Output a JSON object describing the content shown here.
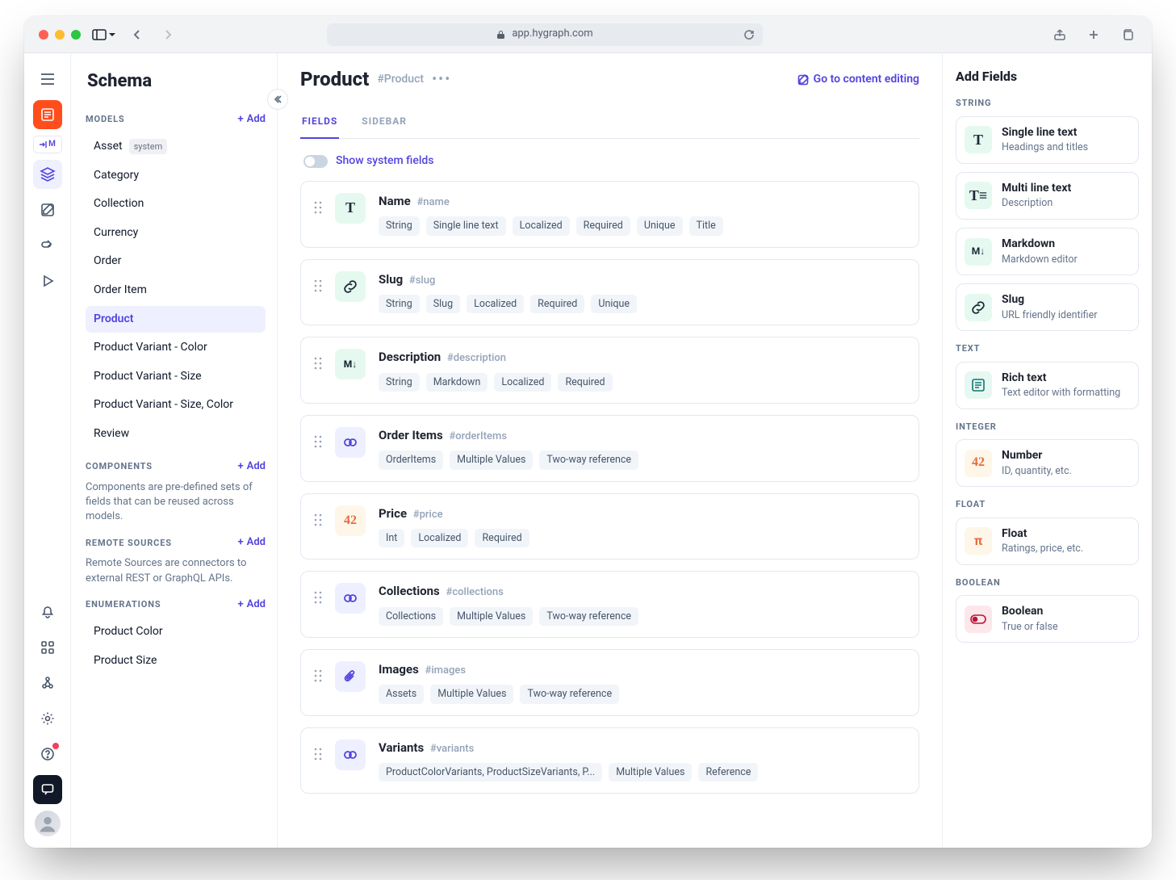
{
  "browser": {
    "url_host": "app.hygraph.com"
  },
  "rail": {
    "brand_short": "M"
  },
  "schema": {
    "title": "Schema",
    "sections": {
      "models": {
        "label": "MODELS",
        "add": "Add",
        "items": [
          {
            "label": "Asset",
            "system": true,
            "sys_label": "system"
          },
          {
            "label": "Category"
          },
          {
            "label": "Collection"
          },
          {
            "label": "Currency"
          },
          {
            "label": "Order"
          },
          {
            "label": "Order Item"
          },
          {
            "label": "Product",
            "active": true
          },
          {
            "label": "Product Variant - Color"
          },
          {
            "label": "Product Variant - Size"
          },
          {
            "label": "Product Variant - Size, Color"
          },
          {
            "label": "Review"
          }
        ]
      },
      "components": {
        "label": "COMPONENTS",
        "add": "Add",
        "help": "Components are pre-defined sets of fields that can be reused across models."
      },
      "remote": {
        "label": "REMOTE SOURCES",
        "add": "Add",
        "help": "Remote Sources are connectors to external REST or GraphQL APIs."
      },
      "enums": {
        "label": "ENUMERATIONS",
        "add": "Add",
        "items": [
          {
            "label": "Product Color"
          },
          {
            "label": "Product Size"
          }
        ]
      }
    }
  },
  "content": {
    "title": "Product",
    "api_id": "#Product",
    "cta": "Go to content editing",
    "tabs": {
      "fields": "FIELDS",
      "sidebar": "SIDEBAR"
    },
    "show_system_label": "Show system fields",
    "fields": [
      {
        "icon": "txt",
        "glyph": "T",
        "name": "Name",
        "hash": "#name",
        "chips": [
          "String",
          "Single line text",
          "Localized",
          "Required",
          "Unique",
          "Title"
        ]
      },
      {
        "icon": "link",
        "glyph": "",
        "name": "Slug",
        "hash": "#slug",
        "chips": [
          "String",
          "Slug",
          "Localized",
          "Required",
          "Unique"
        ]
      },
      {
        "icon": "md",
        "glyph": "M↓",
        "name": "Description",
        "hash": "#description",
        "chips": [
          "String",
          "Markdown",
          "Localized",
          "Required"
        ]
      },
      {
        "icon": "ref",
        "glyph": "",
        "name": "Order Items",
        "hash": "#orderItems",
        "chips": [
          "OrderItems",
          "Multiple Values",
          "Two-way reference"
        ]
      },
      {
        "icon": "num",
        "glyph": "42",
        "name": "Price",
        "hash": "#price",
        "chips": [
          "Int",
          "Localized",
          "Required"
        ]
      },
      {
        "icon": "ref",
        "glyph": "",
        "name": "Collections",
        "hash": "#collections",
        "chips": [
          "Collections",
          "Multiple Values",
          "Two-way reference"
        ]
      },
      {
        "icon": "ref",
        "glyph": "clip",
        "name": "Images",
        "hash": "#images",
        "chips": [
          "Assets",
          "Multiple Values",
          "Two-way reference"
        ]
      },
      {
        "icon": "ref",
        "glyph": "",
        "name": "Variants",
        "hash": "#variants",
        "chips": [
          "ProductColorVariants, ProductSizeVariants, P...",
          "Multiple Values",
          "Reference"
        ]
      }
    ]
  },
  "right": {
    "title": "Add Fields",
    "groups": [
      {
        "label": "STRING",
        "items": [
          {
            "icon": "txt",
            "glyph": "T",
            "title": "Single line text",
            "desc": "Headings and titles"
          },
          {
            "icon": "txt",
            "glyph": "T≡",
            "title": "Multi line text",
            "desc": "Description"
          },
          {
            "icon": "md",
            "glyph": "M↓",
            "title": "Markdown",
            "desc": "Markdown editor"
          },
          {
            "icon": "link",
            "glyph": "",
            "title": "Slug",
            "desc": "URL friendly identifier"
          }
        ]
      },
      {
        "label": "TEXT",
        "items": [
          {
            "icon": "rt",
            "glyph": "",
            "title": "Rich text",
            "desc": "Text editor with formatting"
          }
        ]
      },
      {
        "label": "INTEGER",
        "items": [
          {
            "icon": "num",
            "glyph": "42",
            "title": "Number",
            "desc": "ID, quantity, etc."
          }
        ]
      },
      {
        "label": "FLOAT",
        "items": [
          {
            "icon": "pi",
            "glyph": "π",
            "title": "Float",
            "desc": "Ratings, price, etc."
          }
        ]
      },
      {
        "label": "BOOLEAN",
        "items": [
          {
            "icon": "bool",
            "glyph": "",
            "title": "Boolean",
            "desc": "True or false"
          }
        ]
      }
    ]
  }
}
